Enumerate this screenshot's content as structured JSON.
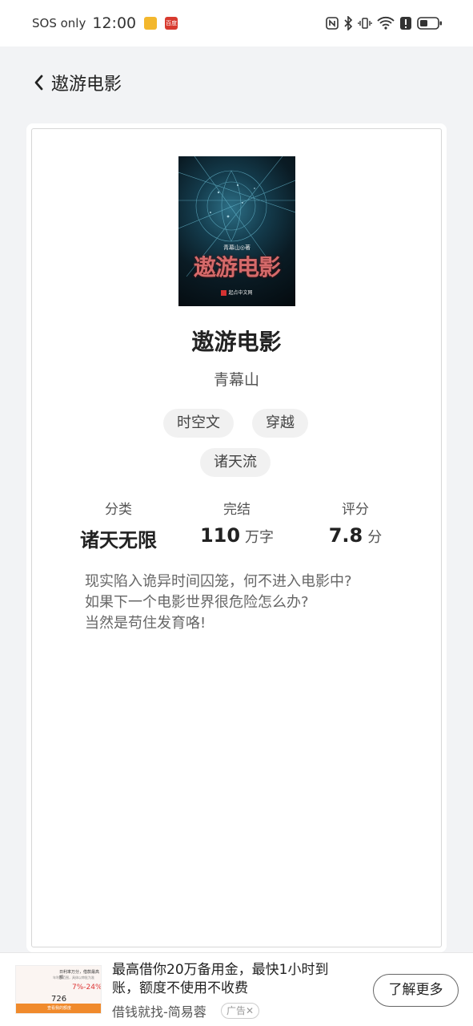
{
  "status_bar": {
    "carrier": "SOS only",
    "time": "12:00",
    "red_app_icon_text": "百度"
  },
  "header": {
    "title": "遨游电影"
  },
  "book": {
    "cover": {
      "title": "遨游电影",
      "author_line": "青幕山◎著",
      "publisher": "起点中文网"
    },
    "title": "遨游电影",
    "author": "青幕山",
    "tags": [
      "时空文",
      "穿越",
      "诸天流"
    ],
    "stats": {
      "category_label": "分类",
      "category_value": "诸天无限",
      "status_label": "完结",
      "words_value": "110",
      "words_unit": "万字",
      "rating_label": "评分",
      "rating_value": "7.8",
      "rating_unit": "分"
    },
    "intro": " 现实陷入诡异时间囚笼，何不进入电影中?\n如果下一个电影世界很危险怎么办?\n当然是苟住发育咯!"
  },
  "ad": {
    "thumb": {
      "line1": "日利率万分，借款最高额",
      "line2": "年利率范围，具体以审批为准",
      "rate": "7%-24%",
      "amount": "726",
      "button": "查看我的额度"
    },
    "text": "最高借你20万备用金，最快1小时到账，额度不使用不收费",
    "source": "借钱就找-简易蓉",
    "tag": "广告✕",
    "button_label": "了解更多"
  }
}
